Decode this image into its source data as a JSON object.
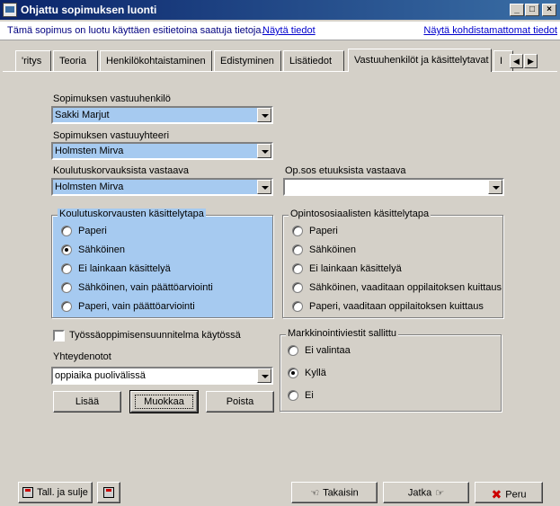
{
  "window": {
    "title": "Ohjattu sopimuksen luonti",
    "minimize": "_",
    "maximize": "□",
    "close": "×"
  },
  "infobar": {
    "message": "Tämä sopimus on luotu käyttäen esitietoina saatuja tietoja.",
    "show_info_link": "Näytä tiedot",
    "show_unassigned_link": "Näytä kohdistamattomat tiedot"
  },
  "tabs": [
    {
      "label": "'ritys"
    },
    {
      "label": "Teoria"
    },
    {
      "label": "Henkilökohtaistaminen"
    },
    {
      "label": "Edistyminen"
    },
    {
      "label": "Lisätiedot"
    },
    {
      "label": "Vastuuhenkilöt ja käsittelytavat"
    },
    {
      "label": "I"
    }
  ],
  "tab_scroll": {
    "left": "◀",
    "right": "▶"
  },
  "form": {
    "responsible_person": {
      "label": "Sopimuksen vastuuhenkilö",
      "value": "Sakki Marjut"
    },
    "responsible_contact": {
      "label": "Sopimuksen vastuuyhteeri",
      "value": "Holmsten Mirva"
    },
    "compensation_responsible": {
      "label": "Koulutuskorvauksista vastaava",
      "value": "Holmsten Mirva"
    },
    "benefits_responsible": {
      "label": "Op.sos etuuksista vastaava",
      "value": ""
    },
    "compensation_method": {
      "legend": "Koulutuskorvausten käsittelytapa",
      "options": [
        "Paperi",
        "Sähköinen",
        "Ei lainkaan käsittelyä",
        "Sähköinen, vain päättöarviointi",
        "Paperi, vain päättöarviointi"
      ],
      "selected": 1
    },
    "study_social_method": {
      "legend": "Opintososiaalisten käsittelytapa",
      "options": [
        "Paperi",
        "Sähköinen",
        "Ei lainkaan käsittelyä",
        "Sähköinen, vaaditaan oppilaitoksen kuittaus",
        "Paperi, vaaditaan oppilaitoksen kuittaus"
      ],
      "selected": -1
    },
    "work_plan_checkbox": {
      "label": "Työssäoppimisensuunnitelma käytössä",
      "checked": false
    },
    "contacts": {
      "label": "Yhteydenotot",
      "value": "oppiaika puolivälissä"
    },
    "buttons": {
      "add": "Lisää",
      "edit": "Muokkaa",
      "delete": "Poista"
    },
    "marketing": {
      "legend": "Markkinointiviestit sallittu",
      "options": [
        "Ei valintaa",
        "Kyllä",
        "Ei"
      ],
      "selected": 1
    }
  },
  "footer": {
    "save_close": "Tall. ja sulje",
    "back": "Takaisin",
    "next": "Jatka",
    "cancel": "Peru"
  },
  "colors": {
    "selection_blue": "#a6caf0",
    "title_bar": "#0a246a",
    "link": "#0000cc"
  }
}
